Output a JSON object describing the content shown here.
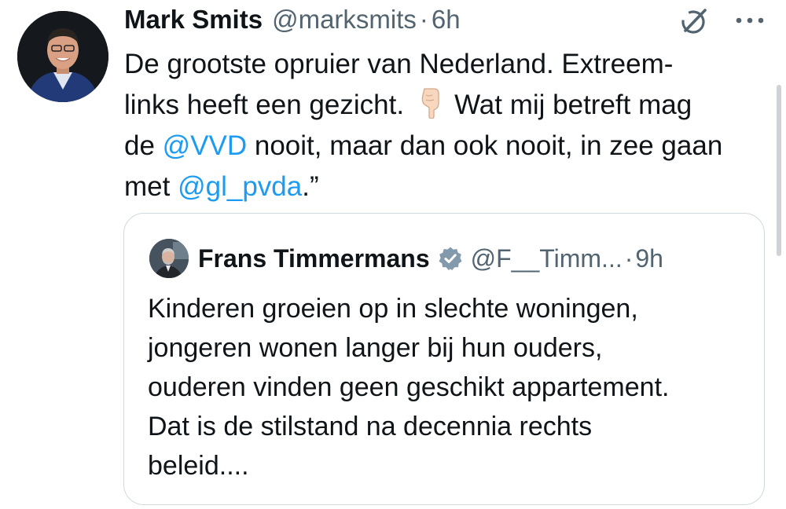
{
  "tweet": {
    "author_name": "Mark Smits",
    "author_handle": "@marksmits",
    "separator": "·",
    "time": "6h",
    "text_lines": {
      "l1": "De grootste opruier van Nederland. Extreem-",
      "l2": "links heeft een gezicht.",
      "l2b": "Wat mij betreft mag",
      "l3a": "de ",
      "l3_mention": "@VVD",
      "l3b": " nooit, maar dan ook nooit, in zee gaan",
      "l4a": "met ",
      "l4_mention": "@gl_pvda",
      "l4b": ".”"
    },
    "emoji": "backhand-index-pointing-down",
    "icons": [
      "grok-icon",
      "more-icon"
    ]
  },
  "quoted_tweet": {
    "author_name": "Frans Timmermans",
    "author_handle": "@F__Timm...",
    "separator": "·",
    "time": "9h",
    "verified": true,
    "text_lines": [
      "Kinderen groeien op in slechte woningen,",
      "jongeren wonen langer bij hun ouders,",
      "ouderen vinden geen geschikt appartement.",
      "Dat is de stilstand na decennia rechts",
      "beleid...."
    ]
  },
  "colors": {
    "text": "#0f1419",
    "secondary": "#536471",
    "link": "#1d9bf0",
    "border": "#cfd9de",
    "verified": "#829aab"
  }
}
